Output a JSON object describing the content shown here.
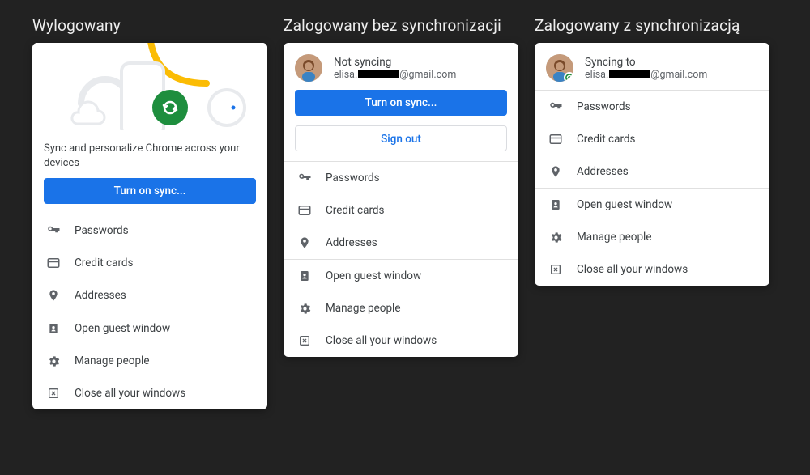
{
  "columns": {
    "a": {
      "title": "Wylogowany"
    },
    "b": {
      "title": "Zalogowany bez synchronizacji"
    },
    "c": {
      "title": "Zalogowany z synchronizacją"
    }
  },
  "a": {
    "hero_text": "Sync and personalize Chrome across your devices",
    "turn_on_sync": "Turn on sync..."
  },
  "b": {
    "profile_title": "Not syncing",
    "email_prefix": "elisa.",
    "email_suffix": "@gmail.com",
    "turn_on_sync": "Turn on sync...",
    "sign_out": "Sign out"
  },
  "c": {
    "profile_title": "Syncing to",
    "email_prefix": "elisa.",
    "email_suffix": "@gmail.com"
  },
  "items": {
    "passwords": "Passwords",
    "credit_cards": "Credit cards",
    "addresses": "Addresses",
    "open_guest": "Open guest window",
    "manage_people": "Manage people",
    "close_all": "Close all your windows"
  }
}
